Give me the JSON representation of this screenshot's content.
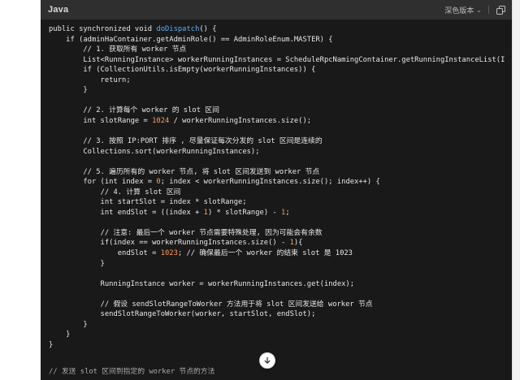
{
  "header": {
    "language": "Java",
    "theme_label": "深色版本",
    "theme_chevron": "⌄",
    "copy_icon": "copy-icon"
  },
  "code": {
    "lines": [
      "public synchronized void doDispatch() {",
      "    if (adminHaContainer.getAdminRole() == AdminRoleEnum.MASTER) {",
      "        // 1. 获取所有 worker 节点",
      "        List<RunningInstance> workerRunningInstances = ScheduleRpcNamingContainer.getRunningInstanceList(I",
      "        if (CollectionUtils.isEmpty(workerRunningInstances)) {",
      "            return;",
      "        }",
      "",
      "        // 2. 计算每个 worker 的 slot 区间",
      "        int slotRange = 1024 / workerRunningInstances.size();",
      "",
      "        // 3. 按照 IP:PORT 排序 , 尽量保证每次分发的 slot 区间是连续的",
      "        Collections.sort(workerRunningInstances);",
      "",
      "        // 5. 遍历所有的 worker 节点, 将 slot 区间发送到 worker 节点",
      "        for (int index = 0; index < workerRunningInstances.size(); index++) {",
      "            // 4. 计算 slot 区间",
      "            int startSlot = index * slotRange;",
      "            int endSlot = ((index + 1) * slotRange) - 1;",
      "",
      "            // 注意: 最后一个 worker 节点需要特殊处理, 因为可能会有余数",
      "            if(index == workerRunningInstances.size() - 1){",
      "                endSlot = 1023; // 确保最后一个 worker 的结束 slot 是 1023",
      "            }",
      "",
      "            RunningInstance worker = workerRunningInstances.get(index);",
      "",
      "            // 假设 sendSlotRangeToWorker 方法用于将 slot 区间发送给 worker 节点",
      "            sendSlotRangeToWorker(worker, startSlot, endSlot);",
      "        }",
      "    }",
      "}"
    ],
    "cut_off_line": "// 发送 slot 区间到指定的 worker 节点的方法"
  },
  "controls": {
    "scroll_down_icon": "arrow-down-icon"
  },
  "colors": {
    "panel_bg": "#191919",
    "header_bg": "#2f2f2f",
    "text": "#e8e8e8",
    "function": "#61aeee",
    "number": "#ff9c5b"
  }
}
